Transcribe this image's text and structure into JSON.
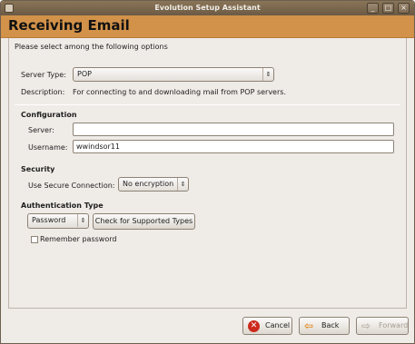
{
  "window": {
    "title": "Evolution Setup Assistant"
  },
  "titlebar_buttons": {
    "minimize": "_",
    "maximize": "□",
    "close": "×"
  },
  "header": {
    "title": "Receiving Email"
  },
  "intro": "Please select among the following options",
  "server_type": {
    "label": "Server Type:",
    "value": "POP"
  },
  "description": {
    "label": "Description:",
    "text": "For connecting to and downloading mail from POP servers."
  },
  "configuration": {
    "heading": "Configuration",
    "server_label": "Server:",
    "server_value": "",
    "username_label": "Username:",
    "username_value": "wwindsor11"
  },
  "security": {
    "heading": "Security",
    "secure_label": "Use Secure Connection:",
    "secure_value": "No encryption"
  },
  "auth": {
    "heading": "Authentication Type",
    "type_value": "Password",
    "check_button": "Check for Supported Types",
    "remember_label": "Remember password",
    "remember_checked": false
  },
  "footer": {
    "cancel": "Cancel",
    "back": "Back",
    "forward": "Forward"
  }
}
